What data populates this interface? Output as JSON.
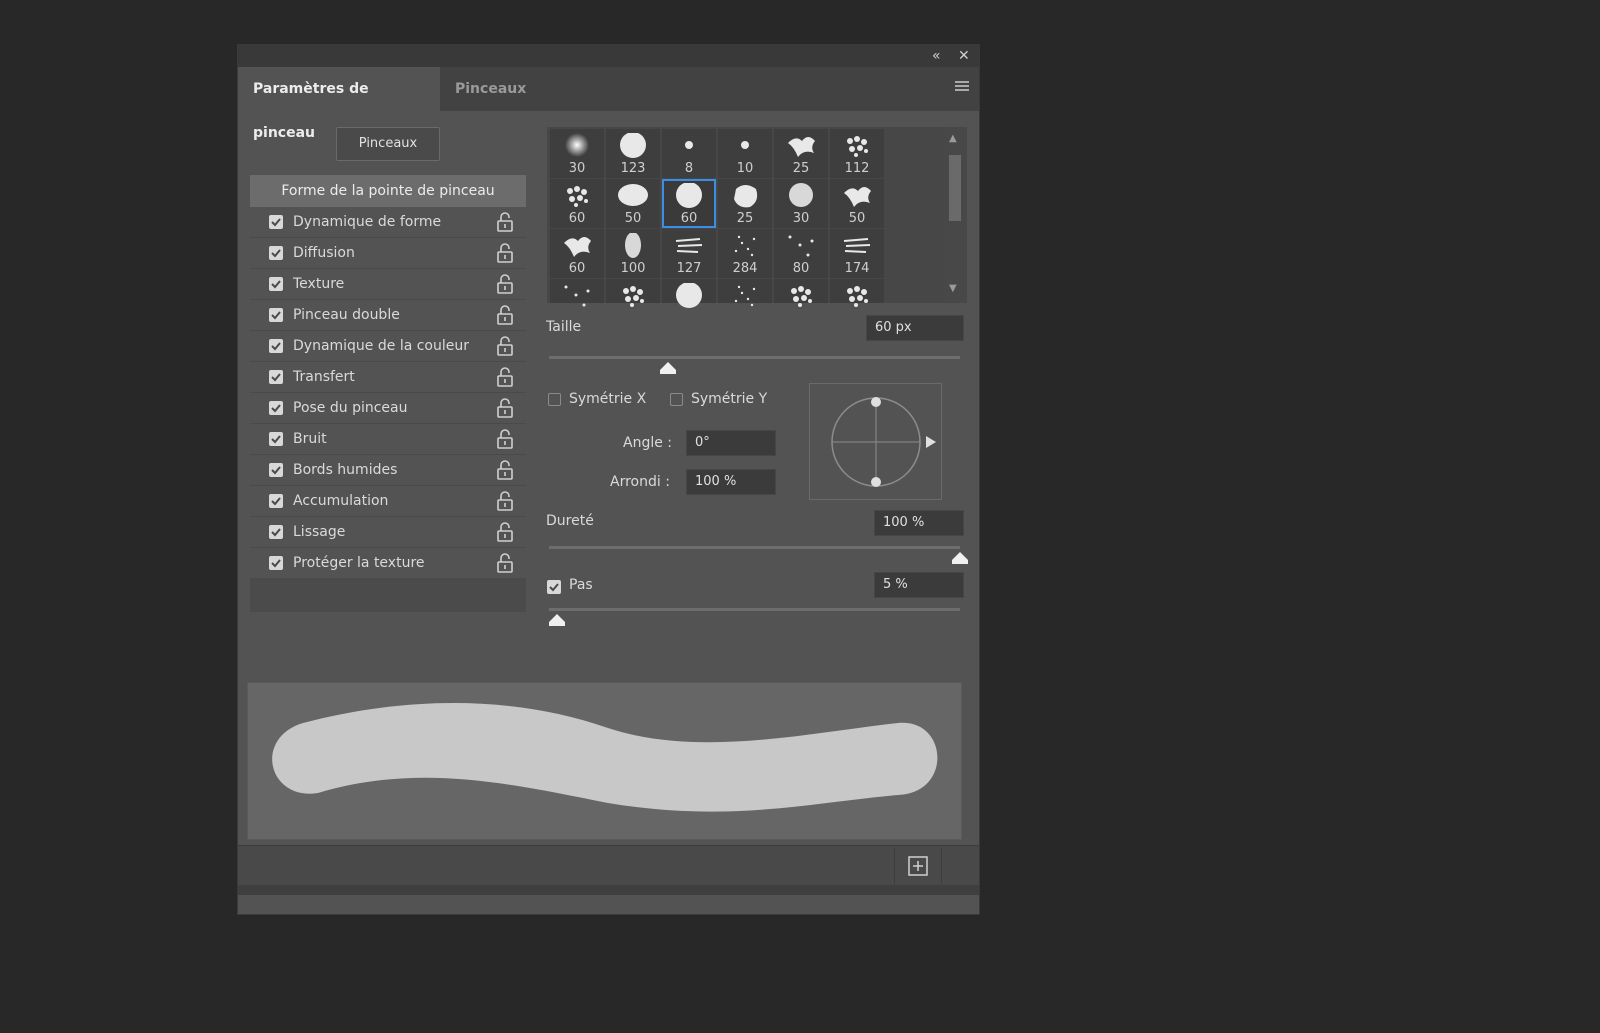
{
  "window": {
    "collapse_label": "«",
    "close_label": "✕",
    "menu_icon": "hamburger-icon"
  },
  "tabs": [
    {
      "label": "Paramètres de pinceau",
      "active": true
    },
    {
      "label": "Pinceaux",
      "active": false
    }
  ],
  "brushes_button": "Pinceaux",
  "sidebar": {
    "header": "Forme de la pointe de pinceau",
    "items": [
      {
        "label": "Dynamique de forme",
        "checked": true
      },
      {
        "label": "Diffusion",
        "checked": true
      },
      {
        "label": "Texture",
        "checked": true
      },
      {
        "label": "Pinceau double",
        "checked": true
      },
      {
        "label": "Dynamique de la couleur",
        "checked": true
      },
      {
        "label": "Transfert",
        "checked": true
      },
      {
        "label": "Pose du pinceau",
        "checked": true
      },
      {
        "label": "Bruit",
        "checked": true
      },
      {
        "label": "Bords humides",
        "checked": true
      },
      {
        "label": "Accumulation",
        "checked": true
      },
      {
        "label": "Lissage",
        "checked": true
      },
      {
        "label": "Protéger la texture",
        "checked": true
      }
    ]
  },
  "brush_presets": {
    "rows": [
      [
        "30",
        "123",
        "8",
        "10",
        "25",
        "112"
      ],
      [
        "60",
        "50",
        "60",
        "25",
        "30",
        "50"
      ],
      [
        "60",
        "100",
        "127",
        "284",
        "80",
        "174"
      ]
    ],
    "selected_row": 1,
    "selected_col": 2
  },
  "size": {
    "label": "Taille",
    "value": "60 px",
    "slider_fraction": 0.29
  },
  "flip": {
    "x_label": "Symétrie X",
    "y_label": "Symétrie Y",
    "x_checked": false,
    "y_checked": false
  },
  "angle": {
    "label": "Angle :",
    "value": "0°"
  },
  "roundness": {
    "label": "Arrondi :",
    "value": "100 %"
  },
  "hardness": {
    "label": "Dureté",
    "value": "100 %",
    "slider_fraction": 1.0
  },
  "spacing": {
    "label": "Pas",
    "value": "5 %",
    "checked": true,
    "slider_fraction": 0.02
  },
  "footer": {
    "new_preset_icon": "new-preset-icon"
  },
  "colors": {
    "panel": "#535353",
    "selection": "#3a8ee6",
    "stroke": "#c8c8c8"
  }
}
